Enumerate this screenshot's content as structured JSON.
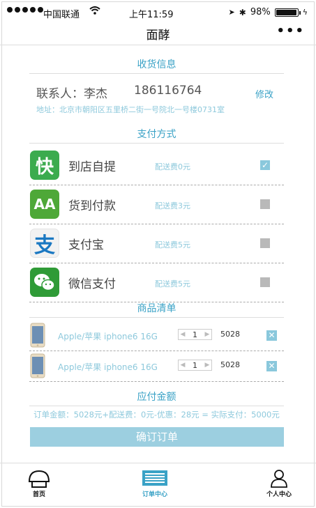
{
  "status_bar": {
    "carrier": "中国联通",
    "time": "上午11:59",
    "battery": "98%",
    "battery_level": 0.98
  },
  "nav": {
    "title": "面酵",
    "more": "•••"
  },
  "receiver": {
    "heading": "收货信息",
    "contact": "联系人：李杰",
    "phone": "186116764",
    "edit": "修改",
    "address": "地址：北京市朝阳区五里桥二街一号院北一号楼0731室"
  },
  "payment": {
    "heading": "支付方式",
    "methods": [
      {
        "name": "到店自提",
        "fee": "配送费0元",
        "checked": true,
        "icon": "kuai-icon",
        "color": "#3bab4e"
      },
      {
        "name": "货到付款",
        "fee": "配送费3元",
        "checked": false,
        "icon": "aa-icon",
        "color": "#4ea838"
      },
      {
        "name": "支付宝",
        "fee": "配送费5元",
        "checked": false,
        "icon": "alipay-icon",
        "color": "#f4f4f4"
      },
      {
        "name": "微信支付",
        "fee": "配送费5元",
        "checked": false,
        "icon": "wechat-icon",
        "color": "#2f9b37"
      }
    ]
  },
  "goods": {
    "heading": "商品清单",
    "items": [
      {
        "name": "Apple/苹果 iphone6 16G",
        "qty": "1",
        "price": "5028"
      },
      {
        "name": "Apple/苹果 iphone6 16G",
        "qty": "1",
        "price": "5028"
      }
    ]
  },
  "amount": {
    "heading": "应付金额",
    "summary": "订单金额：5028元+配送费：0元-优惠：28元 = 实际支付：5000元",
    "confirm": "确订订单"
  },
  "tabs": [
    {
      "label": "首页",
      "icon": "home-icon",
      "active": false
    },
    {
      "label": "订单中心",
      "icon": "order-list-icon",
      "active": true
    },
    {
      "label": "个人中心",
      "icon": "user-icon",
      "active": false
    }
  ],
  "colors": {
    "accent": "#3aa2c6",
    "light_accent": "#8ec9dc",
    "button": "#9ccfe0"
  }
}
